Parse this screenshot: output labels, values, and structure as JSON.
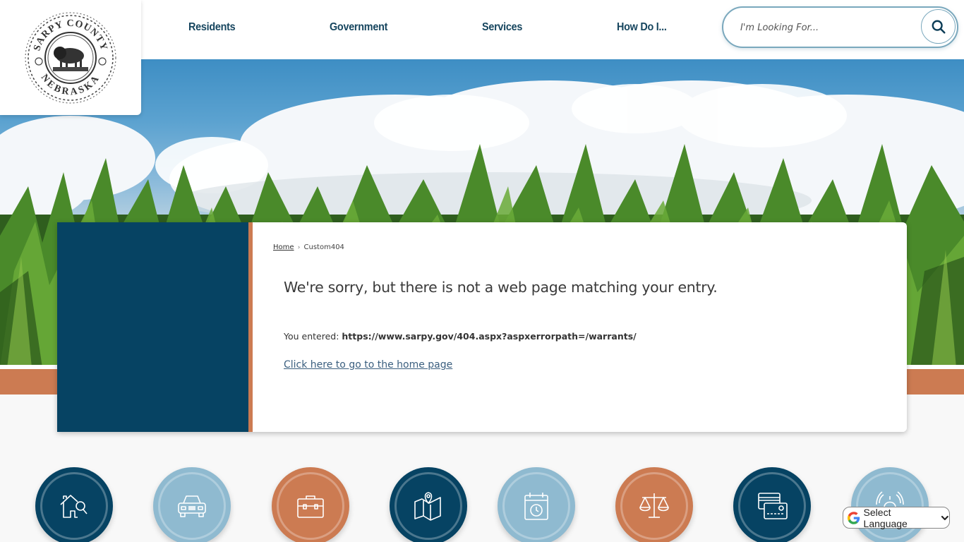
{
  "header": {
    "logo_alt": "Sarpy County Nebraska seal",
    "logo_text_top": "SARPY COUNTY",
    "logo_text_bottom": "NEBRASKA",
    "nav": [
      {
        "label": "Residents"
      },
      {
        "label": "Government"
      },
      {
        "label": "Services"
      },
      {
        "label": "How Do I..."
      }
    ],
    "search": {
      "placeholder": "I'm Looking For...",
      "value": "",
      "button_icon": "search-icon"
    }
  },
  "breadcrumb": {
    "home": "Home",
    "separator": "›",
    "current": "Custom404"
  },
  "content": {
    "heading": "We're sorry, but there is not a web page matching your entry.",
    "entered_label": "You entered: ",
    "entered_url": "https://www.sarpy.gov/404.aspx?aspxerrorpath=/warrants/",
    "home_link": "Click here to go to the home page"
  },
  "quick_links": [
    {
      "icon": "house-search-icon",
      "color": "#064363"
    },
    {
      "icon": "car-icon",
      "color": "#8fbad0"
    },
    {
      "icon": "briefcase-icon",
      "color": "#cc7b52"
    },
    {
      "icon": "map-pin-icon",
      "color": "#064363"
    },
    {
      "icon": "calendar-clock-icon",
      "color": "#8fbad0"
    },
    {
      "icon": "scales-icon",
      "color": "#cc7b52"
    },
    {
      "icon": "payment-card-icon",
      "color": "#064363"
    },
    {
      "icon": "alarm-siren-icon",
      "color": "#8fbad0"
    }
  ],
  "language": {
    "label": "Select Language"
  },
  "colors": {
    "navy": "#064363",
    "orange": "#cc7b52",
    "light_blue": "#8fbad0",
    "nav_text": "#17465f"
  }
}
